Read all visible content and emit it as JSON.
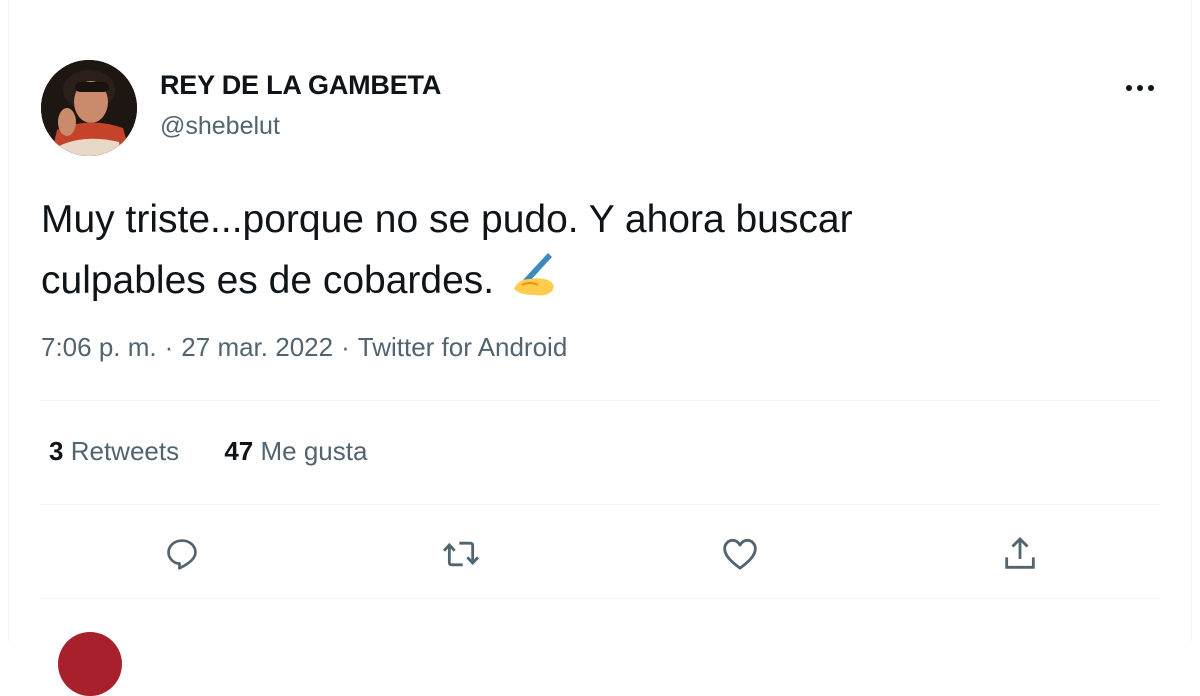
{
  "tweet": {
    "author": {
      "display_name": "REY DE LA GAMBETA",
      "handle": "@shebelut",
      "avatar_icon": "user-avatar"
    },
    "text_line1": "Muy triste...porque no se pudo. Y ahora buscar",
    "text_line2": "culpables es de cobardes.",
    "emoji": "writing-hand-emoji",
    "time": "7:06 p. m.",
    "date": "27 mar. 2022",
    "source": "Twitter for Android",
    "separator": "·",
    "stats": {
      "retweets_count": "3",
      "retweets_label": "Retweets",
      "likes_count": "47",
      "likes_label": "Me gusta"
    },
    "actions": [
      "reply-icon",
      "retweet-icon",
      "like-icon",
      "share-icon"
    ]
  },
  "colors": {
    "text_primary": "#0f1419",
    "text_secondary": "#536471",
    "divider": "#eff3f4"
  }
}
